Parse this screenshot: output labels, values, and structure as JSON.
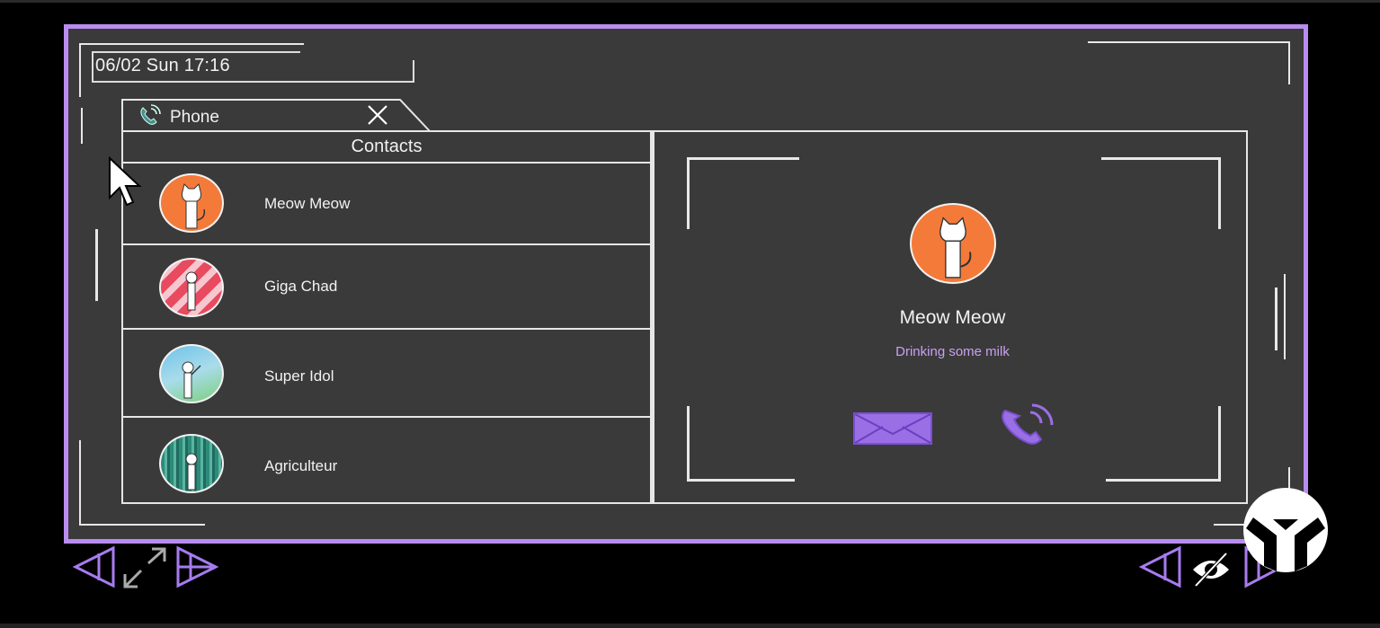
{
  "clock": {
    "datetime": "06/02 Sun 17:16"
  },
  "tab": {
    "label": "Phone",
    "icon": "phone-icon",
    "close_icon": "close-icon"
  },
  "contacts": {
    "header": "Contacts",
    "items": [
      {
        "name": "Meow Meow",
        "avatar": "cat-avatar",
        "color": "#f47a3a"
      },
      {
        "name": "Giga Chad",
        "avatar": "stripes-avatar",
        "color": "#e84a5f"
      },
      {
        "name": "Super Idol",
        "avatar": "sky-avatar",
        "color": "#7cc7e8"
      },
      {
        "name": "Agriculteur",
        "avatar": "forest-avatar",
        "color": "#2e8b7a"
      }
    ]
  },
  "detail": {
    "name": "Meow Meow",
    "status": "Drinking some milk",
    "avatar": "cat-avatar",
    "message_icon": "mail-icon",
    "call_icon": "phone-icon"
  },
  "colors": {
    "accent": "#b98cf0",
    "panel": "#3a3a3a",
    "line": "#e6e6e6"
  },
  "controls": {
    "left": [
      "prev-arrow-icon",
      "resize-icon",
      "next-arrow-icon"
    ],
    "right": [
      "prev-arrow-icon",
      "hide-eye-icon",
      "next-arrow-icon"
    ]
  }
}
